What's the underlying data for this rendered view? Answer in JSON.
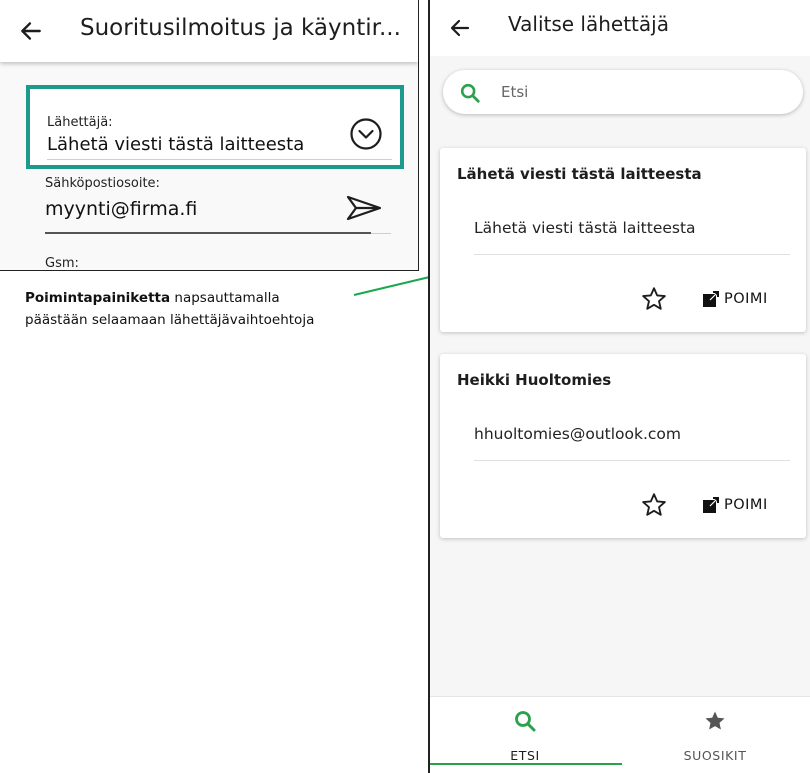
{
  "left": {
    "title": "Suoritusilmoitus ja käyntir...",
    "sender_label": "Lähettäjä:",
    "sender_value": "Lähetä viesti tästä laitteesta",
    "email_label": "Sähköpostiosoite:",
    "email_value": "myynti@firma.fi",
    "gsm_label": "Gsm:"
  },
  "caption": {
    "bold": "Poimintapainiketta",
    "line1_rest": " napsauttamalla",
    "line2": "päästään selaamaan lähettäjävaihtoehtoja"
  },
  "right": {
    "title": "Valitse lähettäjä",
    "search_placeholder": "Etsi",
    "cards": [
      {
        "title": "Lähetä viesti tästä laitteesta",
        "subtitle": "Lähetä viesti tästä laitteesta",
        "pick_label": "POIMI"
      },
      {
        "title": "Heikki Huoltomies",
        "subtitle": "hhuoltomies@outlook.com",
        "pick_label": "POIMI"
      }
    ],
    "nav": [
      {
        "label": "ETSI"
      },
      {
        "label": "SUOSIKIT"
      }
    ]
  },
  "colors": {
    "accent_green": "#2aa14a",
    "teal_highlight": "#1d9a8d",
    "arrow_green": "#1aa84d"
  },
  "icons": [
    "back-arrow-icon",
    "chevron-circle-down-icon",
    "send-icon",
    "search-icon",
    "star-outline-icon",
    "open-external-icon",
    "star-filled-icon"
  ]
}
